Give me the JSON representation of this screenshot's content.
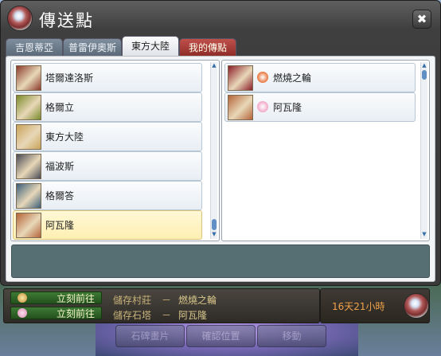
{
  "window": {
    "title": "傳送點",
    "close_label": "✖"
  },
  "tabs": [
    {
      "label": "吉恩蒂亞",
      "active": false
    },
    {
      "label": "普雷伊奧斯",
      "active": false
    },
    {
      "label": "東方大陸",
      "active": true
    },
    {
      "label": "我的傳點",
      "active": false
    }
  ],
  "left_list": [
    {
      "label": "塔爾達洛斯",
      "thumb_color": "#8b3a2a",
      "selected": false
    },
    {
      "label": "格爾立",
      "thumb_color": "#7a8a2a",
      "selected": false
    },
    {
      "label": "東方大陸",
      "thumb_color": "#c9a35a",
      "selected": false
    },
    {
      "label": "福波斯",
      "thumb_color": "#4a4a55",
      "selected": false
    },
    {
      "label": "格爾答",
      "thumb_color": "#3a5e7a",
      "selected": false
    },
    {
      "label": "阿瓦隆",
      "thumb_color": "#b5653a",
      "selected": true
    }
  ],
  "right_list": [
    {
      "label": "燃燒之輪",
      "thumb_color": "#8b1e2a",
      "icon_color": "#e8743a"
    },
    {
      "label": "阿瓦隆",
      "thumb_color": "#b5653a",
      "icon_color": "#f2a6c7"
    }
  ],
  "bottom": {
    "go_label_1": "立刻前往",
    "go_label_2": "立刻前往",
    "save_village_label": "儲存村莊",
    "save_village_value": "燃燒之輪",
    "save_stone_label": "儲存石塔",
    "save_stone_value": "阿瓦隆",
    "dash": "－",
    "timer": "16天21小時"
  },
  "ghost_buttons": [
    "石碑畫片",
    "確認位置",
    "移動"
  ],
  "colors": {
    "accent_green": "#3e7a35",
    "timer_orange": "#f0a24a",
    "selected_row": "#fff2c0",
    "active_tab": "#f5f5f5",
    "my_tab_red": "#a33a34"
  }
}
